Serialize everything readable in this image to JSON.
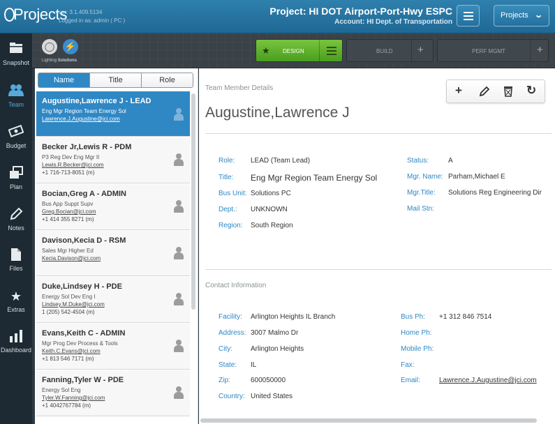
{
  "header": {
    "app_name": "Projects",
    "version": "ver: 3.1.409.5134",
    "logged_in": "Logged in as: admin ( PC )",
    "project_title": "Project: HI DOT Airport-Port-Hwy ESPC",
    "account": "Account: HI Dept. of Transportation",
    "projects_button": "Projects"
  },
  "nav": [
    {
      "label": "Snapshot",
      "icon": "folder-icon"
    },
    {
      "label": "Team",
      "icon": "team-icon",
      "active": true
    },
    {
      "label": "Budget",
      "icon": "money-icon"
    },
    {
      "label": "Plan",
      "icon": "plan-icon"
    },
    {
      "label": "Notes",
      "icon": "pencil-icon"
    },
    {
      "label": "Files",
      "icon": "file-icon"
    },
    {
      "label": "Extras",
      "icon": "star-icon"
    },
    {
      "label": "Dashboard",
      "icon": "bar-chart-icon"
    }
  ],
  "toolbar": {
    "lighting_label_1": "Lighting",
    "lighting_label_2": "Solutions",
    "design": "DESIGN",
    "build": "BUILD",
    "perf": "PERF MGMT"
  },
  "tabs": [
    "Name",
    "Title",
    "Role"
  ],
  "members": [
    {
      "name": "Augustine,Lawrence J - LEAD",
      "title": "Eng Mgr Region Team Energy Sol",
      "email": "Lawrence.J.Augustine@jci.com",
      "phone": ""
    },
    {
      "name": "Becker Jr,Lewis R - PDM",
      "title": "P3 Reg Dev Eng Mgr II",
      "email": "Lewis.R.Becker@jci.com",
      "phone": "+1 716-713-8051 (m)"
    },
    {
      "name": "Bocian,Greg A - ADMIN",
      "title": "Bus App Suppt Supv",
      "email": "Greg.Bocian@jci.com",
      "phone": "+1 414 355 8271 (m)"
    },
    {
      "name": "Davison,Kecia D - RSM",
      "title": "Sales Mgr Higher Ed",
      "email": "Kecia.Davison@jci.com",
      "phone": ""
    },
    {
      "name": "Duke,Lindsey H - PDE",
      "title": "Energy Sol Dev Eng I",
      "email": "Lindsey.M.Duke@jci.com",
      "phone": "1 (205) 542-4504 (m)"
    },
    {
      "name": "Evans,Keith C - ADMIN",
      "title": "Mgr Prog Dev Process & Tools",
      "email": "Keith.C.Evans@jci.com",
      "phone": "+1 813 546 7171 (m)"
    },
    {
      "name": "Fanning,Tyler W - PDE",
      "title": "Energy Sol Eng",
      "email": "Tyler.W.Fanning@jci.com",
      "phone": "+1 4042767784 (m)"
    }
  ],
  "detail": {
    "section_title": "Team Member Details",
    "name": "Augustine,Lawrence J",
    "labels": {
      "role": "Role:",
      "title": "Title:",
      "bus_unit": "Bus Unit:",
      "dept": "Dept.:",
      "region": "Region:",
      "status": "Status:",
      "mgr_name": "Mgr. Name:",
      "mgr_title": "Mgr.Title:",
      "mail_stn": "Mail Stn:"
    },
    "role": "LEAD (Team Lead)",
    "title": "Eng Mgr Region Team Energy Sol",
    "bus_unit": "Solutions PC",
    "dept": "UNKNOWN",
    "region": "South Region",
    "status": "A",
    "mgr_name": "Parham,Michael E",
    "mgr_title": "Solutions Reg Engineering Dir",
    "mail_stn": ""
  },
  "contact": {
    "section_title": "Contact Information",
    "labels": {
      "facility": "Facility:",
      "address": "Address:",
      "city": "City:",
      "state": "State:",
      "zip": "Zip:",
      "country": "Country:",
      "bus_ph": "Bus Ph:",
      "home_ph": "Home Ph:",
      "mobile_ph": "Mobile Ph:",
      "fax": "Fax:",
      "email": "Email:"
    },
    "facility": "Arlington Heights IL Branch",
    "address": "3007 Malmo Dr",
    "city": "Arlington Heights",
    "state": "IL",
    "zip": "600050000",
    "country": "United States",
    "bus_ph": "+1 312 846 7514",
    "home_ph": "",
    "mobile_ph": "",
    "fax": "",
    "email": "Lawrence.J.Augustine@jci.com"
  }
}
